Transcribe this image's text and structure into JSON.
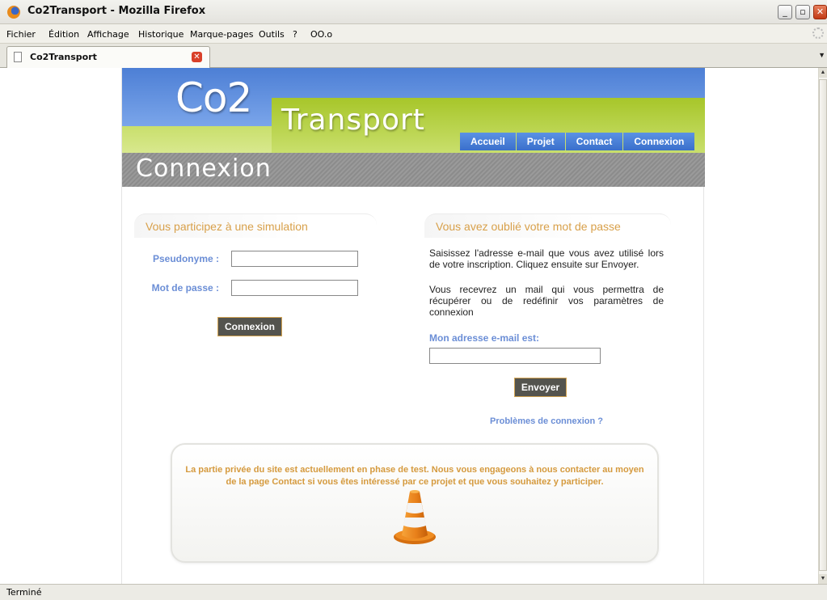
{
  "browser": {
    "window_title": "Co2Transport - Mozilla Firefox",
    "menu": [
      "Fichier",
      "Édition",
      "Affichage",
      "Historique",
      "Marque-pages",
      "Outils",
      "?",
      "OO.o"
    ],
    "tab_title": "Co2Transport",
    "status": "Terminé"
  },
  "site": {
    "logo_co2": "Co2",
    "logo_transport": "Transport",
    "nav": [
      "Accueil",
      "Projet",
      "Contact",
      "Connexion"
    ],
    "banner_title": "Connexion",
    "login": {
      "title": "Vous participez à une simulation",
      "username_label": "Pseudonyme :",
      "username_value": "",
      "password_label": "Mot de passe :",
      "password_value": "",
      "submit_label": "Connexion"
    },
    "forgot": {
      "title": "Vous avez oublié votre mot de passe",
      "para1": "Saisissez l'adresse e-mail que vous avez utilisé lors de votre inscription. Cliquez ensuite sur Envoyer.",
      "para2": "Vous recevrez un mail qui vous permettra de récupérer ou de redéfinir vos paramètres de connexion",
      "email_label": "Mon adresse e-mail est:",
      "email_value": "",
      "submit_label": "Envoyer",
      "problems_link": "Problèmes de connexion ?"
    },
    "notice": "La partie privée du site est actuellement en phase de test. Nous vous engageons à nous contacter au moyen de la page Contact si vous êtes intéressé par ce projet et que vous souhaitez y participer."
  },
  "colors": {
    "header_blue": "#4d7fd5",
    "header_green": "#a7c62a",
    "section_title": "#d8a04a",
    "label_blue": "#6b8ed6",
    "button_bg": "#54544e",
    "notice_text": "#d59a3e"
  },
  "icons": [
    "firefox-icon",
    "page-icon",
    "tab-close-icon",
    "traffic-cone-icon"
  ]
}
